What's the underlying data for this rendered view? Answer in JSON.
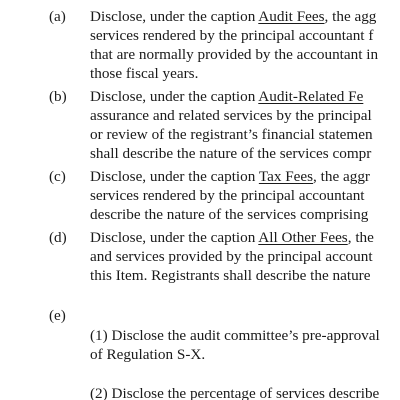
{
  "items": [
    {
      "marker": "(a)",
      "lines": [
        {
          "before": "Disclose, under the caption ",
          "caption": "Audit Fees",
          "after": ", the agg"
        },
        {
          "text": "services rendered by the principal accountant f"
        },
        {
          "text": "that are normally provided by the accountant in"
        },
        {
          "text": "those fiscal years."
        }
      ]
    },
    {
      "marker": "(b)",
      "lines": [
        {
          "before": "Disclose, under the caption ",
          "caption": "Audit-Related Fe",
          "after": ""
        },
        {
          "text": "assurance and related services by the principal"
        },
        {
          "text": "or review of the registrant’s financial statemen"
        },
        {
          "text": "shall describe the nature of the services compr"
        }
      ]
    },
    {
      "marker": "(c)",
      "lines": [
        {
          "before": "Disclose, under the caption ",
          "caption": "Tax Fees",
          "after": ", the aggr"
        },
        {
          "text": "services rendered by the principal accountant"
        },
        {
          "text": "describe the nature of the services comprising"
        }
      ]
    },
    {
      "marker": "(d)",
      "lines": [
        {
          "before": "Disclose, under the caption ",
          "caption": "All Other Fees",
          "after": ", the"
        },
        {
          "text": "and services provided by the principal account"
        },
        {
          "text": "this Item. Registrants shall describe the nature"
        }
      ]
    },
    {
      "marker": "(e)",
      "lines": [
        {
          "text": "(1) Disclose the audit committee’s pre-approval"
        },
        {
          "text": "of Regulation S-X."
        },
        {
          "text": "(2) Disclose the percentage of services describe"
        }
      ]
    }
  ]
}
